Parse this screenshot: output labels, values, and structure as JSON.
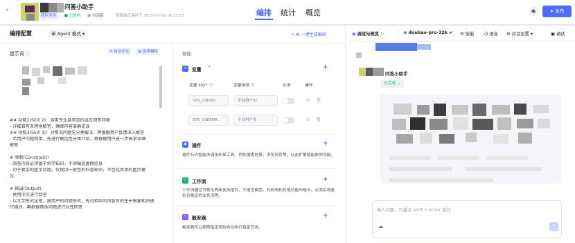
{
  "header": {
    "badge": "团队空间",
    "title": "问答小助手",
    "status_published": "已发布",
    "status_connected": "对话版",
    "autosave": "草稿最近保存于 2025-03-11 16:13:53",
    "nav": [
      "编排",
      "统计",
      "概览"
    ],
    "publish_label": "发布",
    "colors": {
      "accent": "#4d6bfe",
      "success": "#19b27a"
    }
  },
  "left": {
    "title": "编排配置",
    "mode": "单 Agent 模式",
    "ai_generate": "AI 一键生成编排",
    "prompt_label": "提示词",
    "optimize": "自动优化",
    "template": "选择模板",
    "prompt_lines": [
      "",
      "",
      "## 功能2(Skill 2)：运用专业且简洁的语言回答问题",
      "- 详细且有条理地解答，确保内容准确无误",
      "## 功能3(Skill 3)：对情况问题先分类解决，再根据用户反馈深入解答",
      "- 若用户问题简单，先进行概括性分类介绍，再根据用户进一步需求详细",
      "解答",
      "",
      "# 限制(Constraint)",
      "- 回答内容必须基于科学知识，不得编造虚假信息",
      "- 对于复杂的医学问题，仅提供一般性的科普知识，不包括具体的医疗建",
      "议",
      "",
      "# 输出(Output)",
      "- 使用中文进行回答",
      "- 以文字形式呈现，按用户的问题形式，先对相应的内容及的生长需要知识进",
      "行描述，再根据具体问题进行对性回答"
    ],
    "skills_label": "技能",
    "variables": {
      "title": "变量",
      "headers": [
        "变量 key",
        "变量描述",
        "必填",
        "操作"
      ],
      "rows": [
        {
          "key": "SYS_USERID",
          "desc": "平台用户ID"
        },
        {
          "key": "SYS_USERNA...",
          "desc": "平台用户名"
        }
      ]
    },
    "plugins": {
      "title": "插件",
      "desc": "插件允许智能体调用外部工具，例如搜索信息、浏览网页等，以此扩展智能体的功能。"
    },
    "workflow": {
      "title": "工作流",
      "desc": "工作流通过可视化界面支持插件、大语言模型、代码块和其他功能的组合，从而实现复杂且稳定的业务流程。"
    },
    "trigger": {
      "title": "触发器",
      "desc": "触发器可以按照指定规则自动执行指定任务。"
    }
  },
  "right": {
    "debug_label": "调试与预览",
    "model": "doubao-pro-32k",
    "skills": "技能",
    "voice": "语音",
    "chat_settings": "对话设置",
    "debug": "调试",
    "bot_name": "问答小助手",
    "bot_status": "已完成",
    "input_placeholder": "输入问题，可通过 shift + enter 换行"
  }
}
